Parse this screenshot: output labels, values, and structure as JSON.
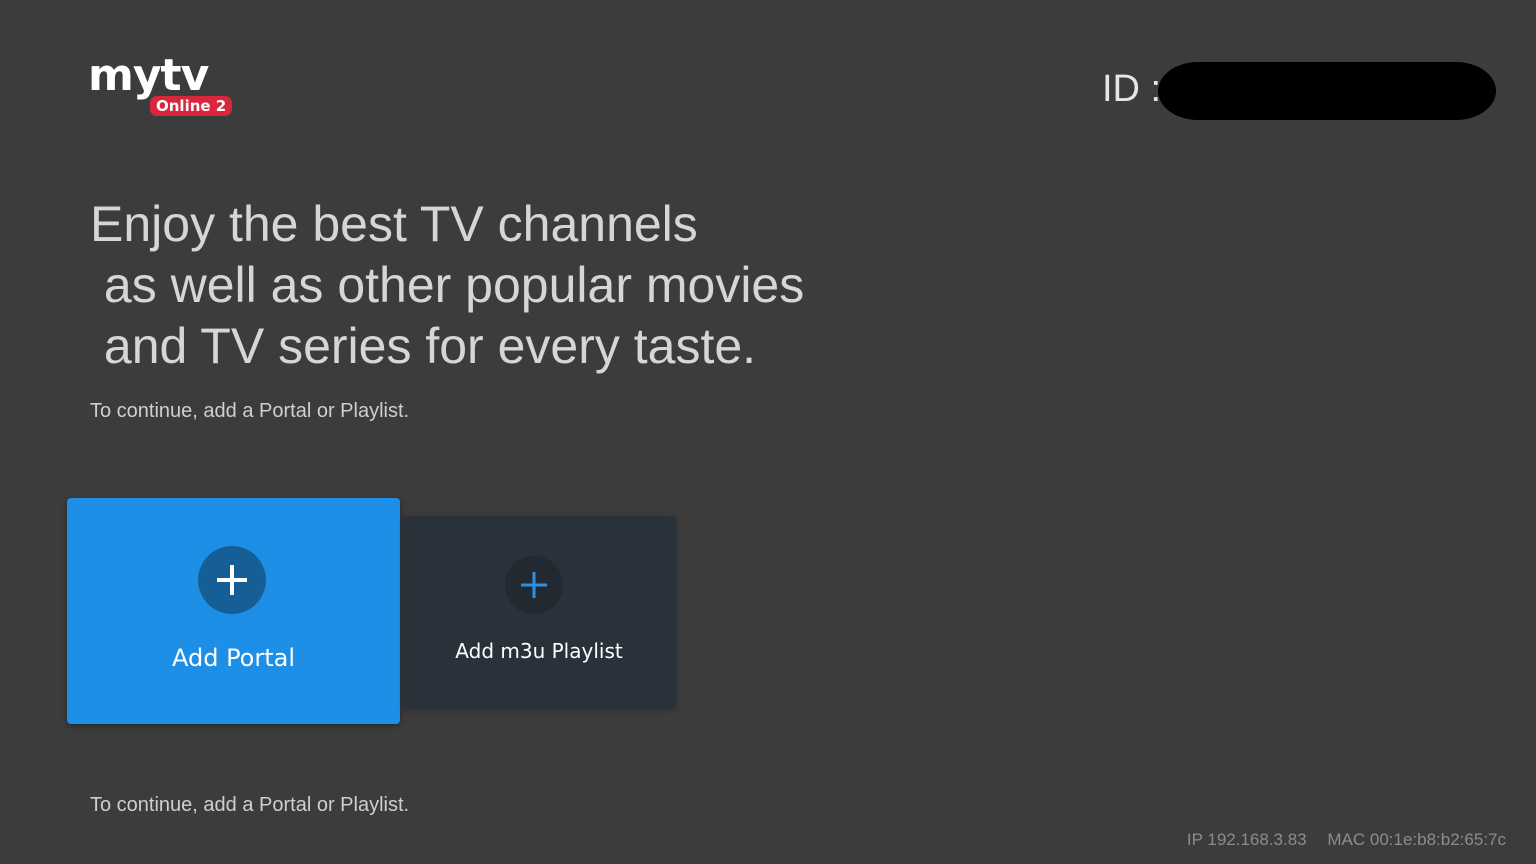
{
  "logo": {
    "wordmark": "mytv",
    "badge": "Online 2"
  },
  "header": {
    "id_label": "ID :"
  },
  "headline": "Enjoy the best TV channels\n as well as other popular movies\n and TV series for every taste.",
  "subtext_top": "To continue, add a Portal or Playlist.",
  "subtext_bottom": "To continue, add a Portal or Playlist.",
  "cards": {
    "add_portal": {
      "label": "Add Portal",
      "icon": "plus-icon"
    },
    "add_playlist": {
      "label": "Add m3u Playlist",
      "icon": "plus-icon"
    }
  },
  "footer": {
    "ip": "IP 192.168.3.83",
    "mac": "MAC 00:1e:b8:b2:65:7c"
  },
  "colors": {
    "background": "#3c3c3c",
    "portal_card": "#1e8fe6",
    "playlist_card": "#29323b",
    "badge": "#d9263d",
    "plus_accent": "#1e8fe6"
  }
}
